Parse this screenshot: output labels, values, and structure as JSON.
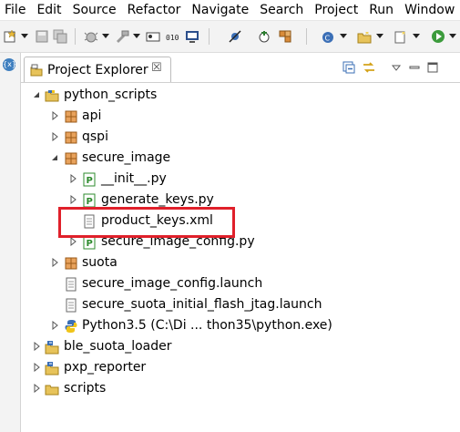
{
  "menu": [
    "File",
    "Edit",
    "Source",
    "Refactor",
    "Navigate",
    "Search",
    "Project",
    "Run",
    "Window"
  ],
  "gutter": {
    "icon_text": "{x}"
  },
  "view": {
    "title": "Project Explorer",
    "close_glyph": "☒"
  },
  "tree": [
    {
      "label": "python_scripts",
      "icon": "python-project-icon",
      "expanded": true,
      "depth": 0
    },
    {
      "label": "api",
      "icon": "package-icon",
      "expanded": false,
      "depth": 1
    },
    {
      "label": "qspi",
      "icon": "package-icon",
      "expanded": false,
      "depth": 1
    },
    {
      "label": "secure_image",
      "icon": "package-icon",
      "expanded": true,
      "depth": 1
    },
    {
      "label": "__init__.py",
      "icon": "python-file-icon",
      "expanded": false,
      "depth": 2
    },
    {
      "label": "generate_keys.py",
      "icon": "python-file-icon",
      "expanded": false,
      "depth": 2
    },
    {
      "label": "product_keys.xml",
      "icon": "file-icon",
      "depth": 2
    },
    {
      "label": "secure_image_config.py",
      "icon": "python-file-icon",
      "expanded": false,
      "depth": 2
    },
    {
      "label": "suota",
      "icon": "package-icon",
      "expanded": false,
      "depth": 1
    },
    {
      "label": "secure_image_config.launch",
      "icon": "file-icon",
      "depth": 1
    },
    {
      "label": "secure_suota_initial_flash_jtag.launch",
      "icon": "file-icon",
      "depth": 1
    },
    {
      "label": "Python3.5  (C:\\Di ... thon35\\python.exe)",
      "icon": "python-interpreter-icon",
      "expanded": false,
      "depth": 1
    },
    {
      "label": "ble_suota_loader",
      "icon": "project-folder-icon",
      "expanded": false,
      "depth": 0
    },
    {
      "label": "pxp_reporter",
      "icon": "project-folder-icon",
      "expanded": false,
      "depth": 0
    },
    {
      "label": "scripts",
      "icon": "folder-icon",
      "expanded": false,
      "depth": 0
    }
  ],
  "colors": {
    "highlight": "#e0202a",
    "package": "#b86a1e",
    "python_file": "#2e8b2e",
    "selection_box": "#e0202a"
  }
}
